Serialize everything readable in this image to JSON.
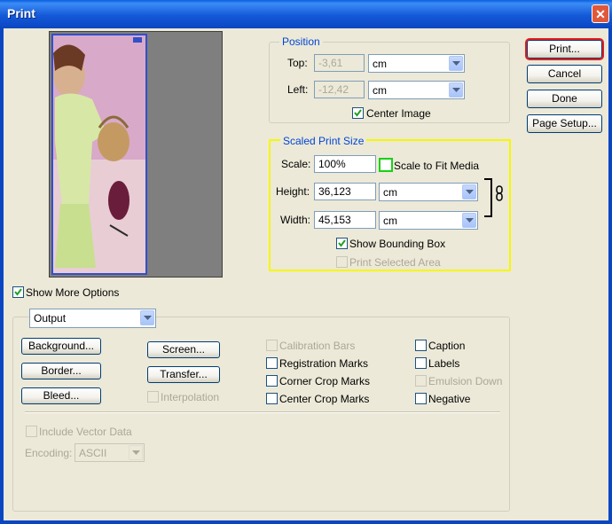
{
  "window": {
    "title": "Print",
    "close_glyph": "✕"
  },
  "buttons": {
    "print": "Print...",
    "cancel": "Cancel",
    "done": "Done",
    "page_setup": "Page Setup..."
  },
  "position": {
    "legend": "Position",
    "top_label": "Top:",
    "top_value": "-3,61",
    "top_unit": "cm",
    "left_label": "Left:",
    "left_value": "-12,42",
    "left_unit": "cm",
    "center_image_label": "Center Image",
    "center_image_checked": true
  },
  "scaled": {
    "legend": "Scaled Print Size",
    "scale_label": "Scale:",
    "scale_value": "100%",
    "scale_to_fit_label": "Scale to Fit Media",
    "scale_to_fit_checked": false,
    "height_label": "Height:",
    "height_value": "36,123",
    "height_unit": "cm",
    "width_label": "Width:",
    "width_value": "45,153",
    "width_unit": "cm",
    "show_bounding_box_label": "Show Bounding Box",
    "show_bounding_box_checked": true,
    "print_selected_area_label": "Print Selected Area",
    "print_selected_area_checked": false,
    "link_icon": "chain-link-icon"
  },
  "more_options": {
    "label": "Show More Options",
    "checked": true
  },
  "output": {
    "dropdown_value": "Output",
    "buttons": {
      "background": "Background...",
      "border": "Border...",
      "bleed": "Bleed...",
      "screen": "Screen...",
      "transfer": "Transfer..."
    },
    "interpolation_label": "Interpolation",
    "col_a": [
      {
        "label": "Calibration Bars",
        "checked": false,
        "enabled": false
      },
      {
        "label": "Registration Marks",
        "checked": false,
        "enabled": true
      },
      {
        "label": "Corner Crop Marks",
        "checked": false,
        "enabled": true
      },
      {
        "label": "Center Crop Marks",
        "checked": false,
        "enabled": true
      }
    ],
    "col_b": [
      {
        "label": "Caption",
        "checked": false,
        "enabled": true
      },
      {
        "label": "Labels",
        "checked": false,
        "enabled": true
      },
      {
        "label": "Emulsion Down",
        "checked": false,
        "enabled": false
      },
      {
        "label": "Negative",
        "checked": false,
        "enabled": true
      }
    ],
    "include_vector_label": "Include Vector Data",
    "encoding_label": "Encoding:",
    "encoding_value": "ASCII"
  },
  "colors": {
    "title_bar": "#0b46c2",
    "dialog_bg": "#ece9d8",
    "legend_blue": "#0046d5",
    "highlight_yellow": "#f7f700",
    "highlight_green": "#18d018",
    "highlight_red": "#e61c1c"
  }
}
